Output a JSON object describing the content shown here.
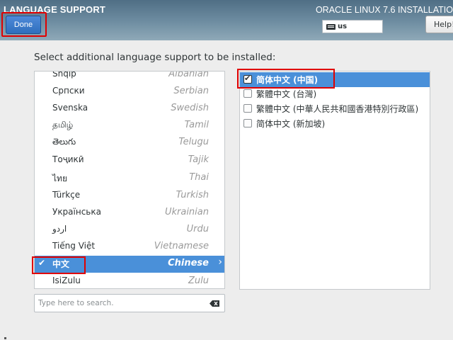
{
  "header": {
    "title": "LANGUAGE SUPPORT",
    "product": "ORACLE LINUX 7.6 INSTALLATIO",
    "done_label": "Done",
    "keyboard_layout": "us",
    "help_label": "Help!"
  },
  "main": {
    "prompt": "Select additional language support to be installed:"
  },
  "languages": [
    {
      "native": "Shqip",
      "english": "Albanian"
    },
    {
      "native": "Српски",
      "english": "Serbian"
    },
    {
      "native": "Svenska",
      "english": "Swedish"
    },
    {
      "native": "தமிழ்",
      "english": "Tamil"
    },
    {
      "native": "తెలుగు",
      "english": "Telugu"
    },
    {
      "native": "Тоҷикӣ",
      "english": "Tajik"
    },
    {
      "native": "ไทย",
      "english": "Thai"
    },
    {
      "native": "Türkçe",
      "english": "Turkish"
    },
    {
      "native": "Українська",
      "english": "Ukrainian"
    },
    {
      "native": "اردو",
      "english": "Urdu"
    },
    {
      "native": "Tiếng Việt",
      "english": "Vietnamese"
    },
    {
      "native": "中文",
      "english": "Chinese",
      "selected": true
    },
    {
      "native": "IsiZulu",
      "english": "Zulu"
    }
  ],
  "search": {
    "placeholder": "Type here to search."
  },
  "locales": [
    {
      "label": "简体中文 (中国)",
      "checked": true,
      "selected": true
    },
    {
      "label": "繁體中文 (台灣)",
      "checked": false
    },
    {
      "label": "繁體中文 (中華人民共和國香港特別行政區)",
      "checked": false
    },
    {
      "label": "简体中文 (新加坡)",
      "checked": false
    }
  ],
  "colors": {
    "header": "#6f8ea2",
    "selection": "#4a90d9",
    "highlight": "#e00000"
  }
}
